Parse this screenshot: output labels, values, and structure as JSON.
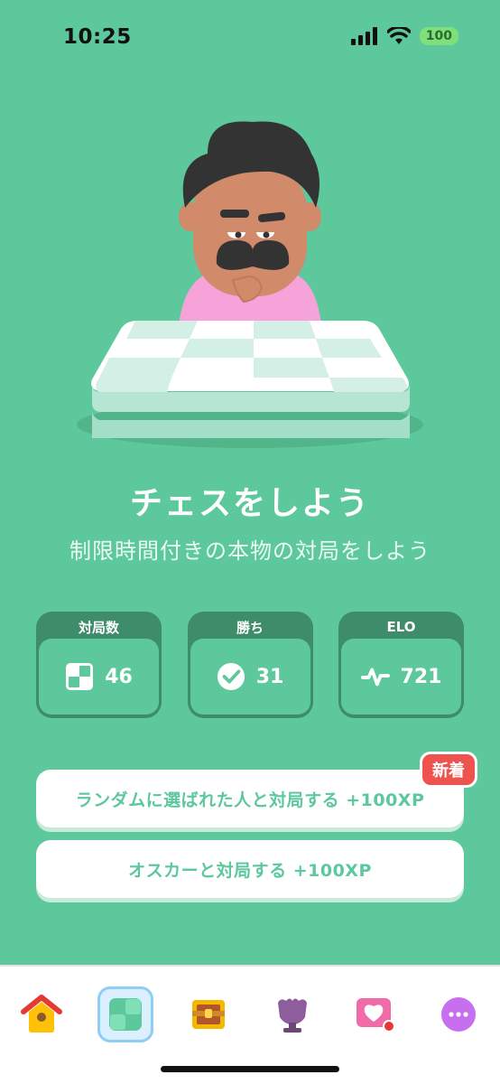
{
  "status": {
    "time": "10:25",
    "battery": "100"
  },
  "hero": {
    "title": "チェスをしよう",
    "subtitle": "制限時間付きの本物の対局をしよう"
  },
  "stats": [
    {
      "label": "対局数",
      "value": "46",
      "icon": "chessboard-icon"
    },
    {
      "label": "勝ち",
      "value": "31",
      "icon": "checkmark-icon"
    },
    {
      "label": "ELO",
      "value": "721",
      "icon": "pulse-icon"
    }
  ],
  "actions": {
    "random_label": "ランダムに選ばれた人と対局する +100XP",
    "new_badge": "新着",
    "oscar_label": "オスカーと対局する +100XP"
  },
  "tabs": [
    "home-icon",
    "chess-icon",
    "treasure-chest-icon",
    "league-trophy-icon",
    "heart-shop-icon",
    "more-icon"
  ],
  "colors": {
    "background": "#5cc89c",
    "card": "#3e8c6a",
    "badge": "#ef5350",
    "selected_tab": "#dcefff"
  }
}
